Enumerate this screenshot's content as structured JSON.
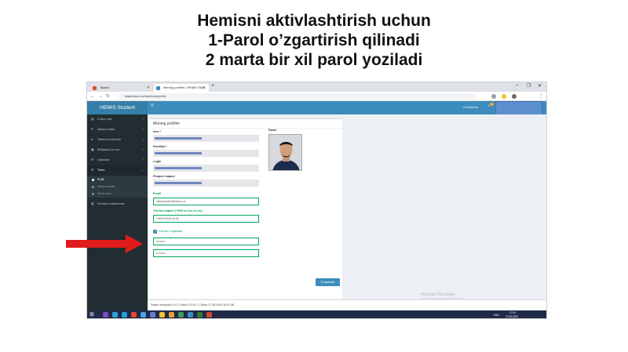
{
  "slide": {
    "title_lines": [
      "Hemisni aktivlashtirish uchun",
      "1-Parol o’zgartirish qilinadi",
      "2 marta bir xil parol yoziladi"
    ]
  },
  "browser": {
    "tabs": [
      {
        "label": "Talaba",
        "active": false
      },
      {
        "label": "Mening profilim | HEMIS Stud...",
        "active": true
      }
    ],
    "new_tab": "+",
    "address": "talaba.hemis.uz/dashboard/profile",
    "win_controls": [
      "–",
      "❐",
      "✕"
    ]
  },
  "app": {
    "brand": "HEMIS Student",
    "menu_toggle": "≡",
    "language": "O'zbekcha",
    "notifications_badge": "1",
    "sidebar": [
      {
        "label": "O'quv reja",
        "icon": "book-icon",
        "chevron": "‹"
      },
      {
        "label": "Qayta o'qish",
        "icon": "refresh-icon",
        "chevron": "‹"
      },
      {
        "label": "Talaba ma'lumoti",
        "icon": "user-icon",
        "chevron": "‹"
      },
      {
        "label": "Moliyaviy ko'rsa",
        "icon": "money-icon",
        "chevron": "‹"
      },
      {
        "label": "Xabarlar",
        "icon": "envelope-icon",
        "chevron": "‹"
      },
      {
        "label": "Tizim",
        "icon": "gear-icon",
        "chevron": "⌄"
      }
    ],
    "sidebar_sub": [
      {
        "label": "Profil",
        "active": true
      },
      {
        "label": "Xabarnomalar",
        "active": false
      },
      {
        "label": "Kirish tarixi",
        "active": false
      }
    ],
    "sidebar_last": {
      "label": "Elektron kutubxona",
      "icon": "library-icon"
    }
  },
  "profile": {
    "panel_title": "Mening profilim",
    "fields": [
      {
        "label": "Ismi *",
        "type": "readonly"
      },
      {
        "label": "Familiya *",
        "type": "readonly"
      },
      {
        "label": "Login",
        "type": "readonly"
      },
      {
        "label": "Pasport raqami",
        "type": "readonly"
      }
    ],
    "email_label": "Email",
    "email_value": "xtemsstudent@hemis.uz",
    "phone_label": "Telefon raqami (+998 xx xxx-xx-xx)",
    "phone_value": "+998 93 026-00-06",
    "photo_label": "Rasm",
    "change_password_label": "Parolni o'zgartirish",
    "password1": "••••••••••",
    "password2": "••••••••••",
    "save_button": "O'zgartirish"
  },
  "footer": {
    "text": "Dastur versiyasi 0.9.2 | Yadro 2.0.41.1 | Sana 27.08.2024 16:57:58"
  },
  "watermark": {
    "line1": "Activate Windows",
    "line2": "Go to Settings to activate Windows."
  },
  "taskbar": {
    "start": "⊞",
    "time": "17:00",
    "date": "27.08.2024",
    "lang": "ENG",
    "icon_colors": [
      "#7b4cc0",
      "#2aa3e0",
      "#23a0dc",
      "#e04b2a",
      "#4aa3e8",
      "#6a7bd0",
      "#f1c232",
      "#e8a13a",
      "#3aa057",
      "#3c8dbc",
      "#2e7d32",
      "#d04a2a"
    ]
  },
  "colors": {
    "brand_blue": "#3c8dbc",
    "sidebar_dark": "#222d32",
    "success_green": "#00a65a",
    "arrow_red": "#e01b1b"
  }
}
